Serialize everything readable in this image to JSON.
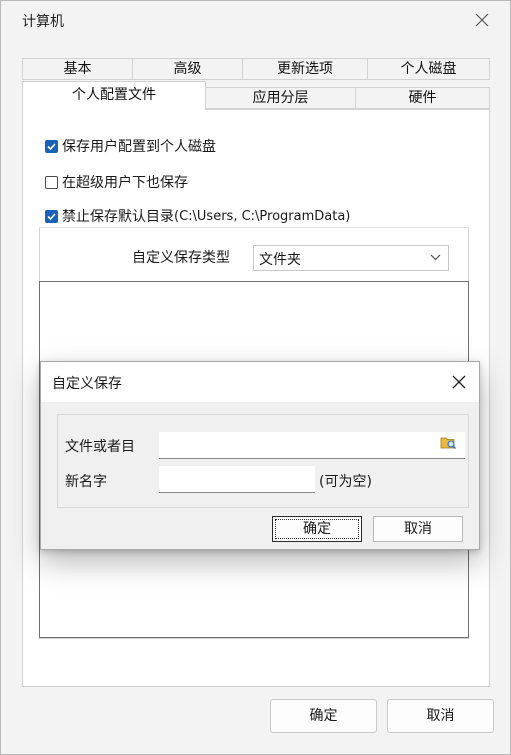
{
  "window": {
    "title": "计算机"
  },
  "tabs_row1": [
    "基本",
    "高级",
    "更新选项",
    "个人磁盘"
  ],
  "tabs_row2": [
    "个人配置文件",
    "应用分层",
    "硬件"
  ],
  "options": {
    "save_profile": {
      "label": "保存用户配置到个人磁盘",
      "checked": true
    },
    "super_user": {
      "label": "在超级用户下也保存",
      "checked": false
    },
    "block_default": {
      "label_prefix": "禁止保存默认目录",
      "label_suffix": "(C:\\Users, C:\\ProgramData)",
      "checked": true
    }
  },
  "custom_type": {
    "label": "自定义保存类型",
    "value": "文件夹"
  },
  "footer": {
    "ok": "确定",
    "cancel": "取消"
  },
  "dialog": {
    "title": "自定义保存",
    "file_label": "文件或者目",
    "file_value": "",
    "name_label": "新名字",
    "name_value": "",
    "name_hint": "(可为空)",
    "ok": "确定",
    "cancel": "取消"
  },
  "colors": {
    "accent": "#1a62b8"
  }
}
